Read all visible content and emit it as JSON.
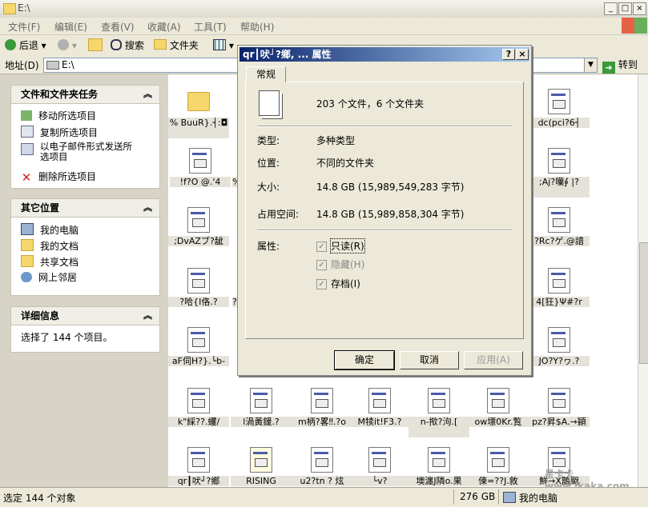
{
  "window": {
    "title": "E:\\"
  },
  "menu": [
    "文件(F)",
    "编辑(E)",
    "查看(V)",
    "收藏(A)",
    "工具(T)",
    "帮助(H)"
  ],
  "toolbar": {
    "back": "后退",
    "search": "搜索",
    "folders": "文件夹"
  },
  "address": {
    "label": "地址(D)",
    "value": "E:\\",
    "go": "转到"
  },
  "left": {
    "tasks": {
      "title": "文件和文件夹任务",
      "items": [
        "移动所选项目",
        "复制所选项目",
        "以电子邮件形式发送所选项目",
        "删除所选项目"
      ]
    },
    "other": {
      "title": "其它位置",
      "items": [
        "我的电脑",
        "我的文档",
        "共享文档",
        "网上邻居"
      ]
    },
    "details": {
      "title": "详细信息",
      "text": "选择了 144 个项目。"
    }
  },
  "files": {
    "col1": [
      "% BuuR}.┤:◘",
      "!f?O @.'4",
      ";DvAZブ?龇",
      "?哈{I佫.?",
      "aF伺H?}.└b-",
      "k\"綵??.蠼/",
      "qr┃吠┘?鄉"
    ],
    "row_bottom": [
      "l渦黃鍰.?",
      "m柄?畧‼.?o",
      "M犊it!F3.?",
      "n-揿?泃.[",
      "ow墂0Kr.覧",
      "pz?昇$A.→顈"
    ],
    "row_last": [
      "RISING",
      "u2?tn ? 炫",
      "└v?",
      "墺瀍J隣o.果",
      "倲=??J.敘",
      "鮮→X鵲颬"
    ],
    "col_right": [
      "dc(pci?6┤",
      ";Aj?囒∮ |?",
      "?Rc?ゲ.@諳",
      "4[狂}Ψ#?r",
      "JO?Y?ヮ.?"
    ],
    "col2_partial": [
      "%",
      "?"
    ]
  },
  "status": {
    "left": "选定 144 个对象",
    "size": "276 GB",
    "location": "我的电脑"
  },
  "watermark": "星卡卡 www.ikaka.com",
  "dialog": {
    "title": "qr┃吠┘?鄉, ... 属性",
    "tab": "常规",
    "summary": "203 个文件，6 个文件夹",
    "type_label": "类型:",
    "type_value": "多种类型",
    "location_label": "位置:",
    "location_value": "不同的文件夹",
    "size_label": "大小:",
    "size_value": "14.8 GB (15,989,549,283 字节)",
    "disk_label": "占用空间:",
    "disk_value": "14.8 GB (15,989,858,304 字节)",
    "attr_label": "属性:",
    "attrs": [
      "只读(R)",
      "隐藏(H)",
      "存档(I)"
    ],
    "ok": "确定",
    "cancel": "取消",
    "apply": "应用(A)"
  }
}
